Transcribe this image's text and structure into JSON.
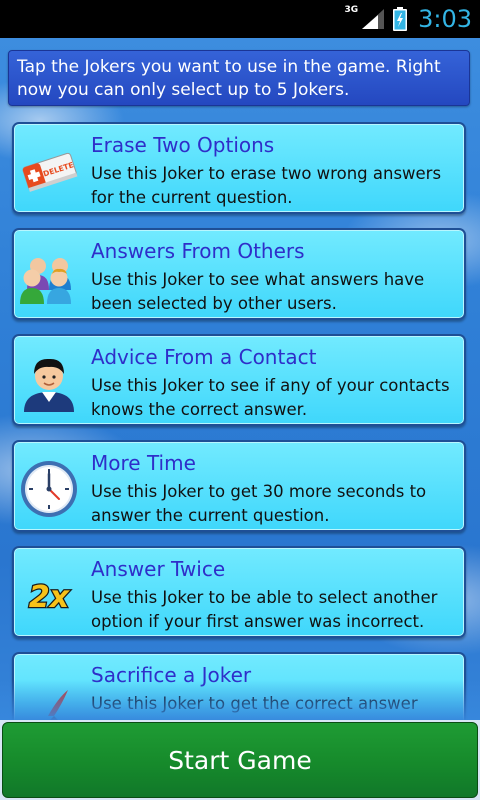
{
  "status_bar": {
    "network": "3G",
    "time": "3:03",
    "icons": [
      "signal-icon",
      "battery-charging-icon"
    ],
    "accent_color": "#33b5e5"
  },
  "instruction": "Tap the Jokers you want to use in the game. Right now you can only select up to 5 Jokers.",
  "jokers": [
    {
      "title": "Erase Two Options",
      "description": "Use this Joker to erase two wrong answers for the current question.",
      "icon": "eraser-icon",
      "icon_text": "DELETE"
    },
    {
      "title": "Answers From Others",
      "description": "Use this Joker to see what answers have been selected by other users.",
      "icon": "users-group-icon"
    },
    {
      "title": "Advice From a Contact",
      "description": "Use this Joker to see if any of your contacts knows the correct answer.",
      "icon": "contact-person-icon"
    },
    {
      "title": "More Time",
      "description": "Use this Joker to get 30 more seconds to answer the current question.",
      "icon": "clock-icon"
    },
    {
      "title": "Answer Twice",
      "description": "Use this Joker to be able to select another option if your first answer was incorrect.",
      "icon": "double-answer-icon",
      "icon_text": "2x"
    },
    {
      "title": "Sacrifice a Joker",
      "description": "Use this Joker to get the correct answer",
      "icon": "sacrifice-icon"
    }
  ],
  "start_button_label": "Start Game",
  "colors": {
    "card_fill": "#4fdcfd",
    "card_border": "#1e4f96",
    "title_text": "#2f2ec9",
    "instruction_fill": "#2c55cc",
    "start_button": "#1a9130"
  }
}
